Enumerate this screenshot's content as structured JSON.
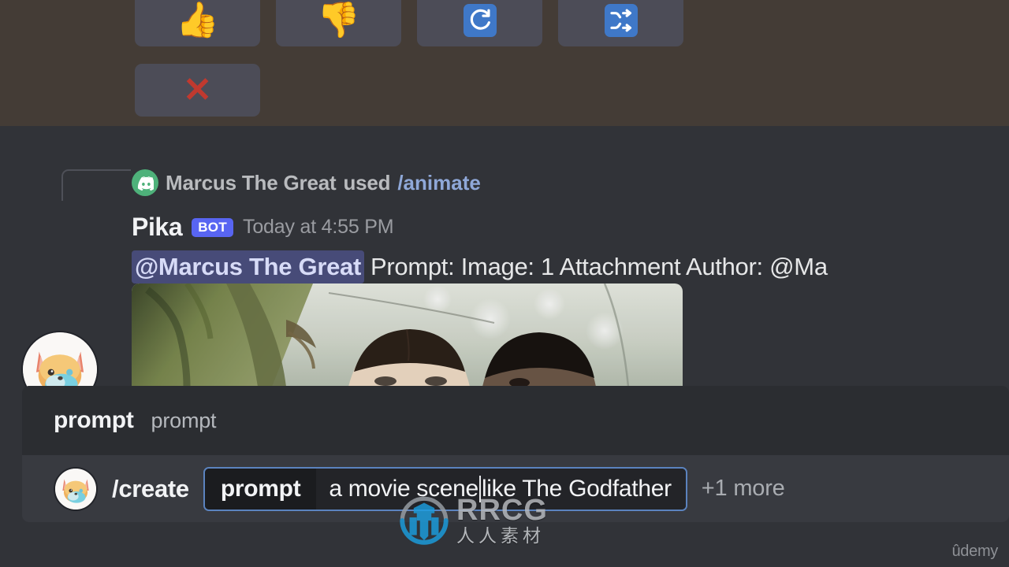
{
  "reactions": {
    "buttons": [
      {
        "name": "thumbs-up",
        "glyph": "👍",
        "kind": "emoji"
      },
      {
        "name": "thumbs-down",
        "glyph": "👎",
        "kind": "emoji"
      },
      {
        "name": "reload",
        "glyph": "🔄",
        "kind": "tile-icon"
      },
      {
        "name": "shuffle",
        "glyph": "🔀",
        "kind": "tile-icon"
      },
      {
        "name": "cancel",
        "glyph": "❌",
        "kind": "x"
      }
    ],
    "tile_color": "#3f78c8",
    "button_bg": "#4c4c57",
    "highlight_bg": "#443c36"
  },
  "message": {
    "reply_user": "Marcus The Great",
    "reply_used_word": "used",
    "reply_command": "/animate",
    "author": "Pika",
    "bot_badge": "BOT",
    "timestamp": "Today at 4:55 PM",
    "mention": "@Marcus The Great",
    "fields": "Prompt:   Image: 1 Attachment  Author: @Ma",
    "accent_blurple": "#5865f2",
    "mention_bg": "#474b78"
  },
  "option_hint": {
    "name": "prompt",
    "description": "prompt"
  },
  "composer": {
    "command": "/create",
    "param_key": "prompt",
    "param_value_before_caret": "a movie scene",
    "param_value_after_caret": "like The Godfather",
    "more_label": "+1 more",
    "border_color": "#5b83bf"
  },
  "watermarks": {
    "rrcg_title": "RRCG",
    "rrcg_sub": "人人素材",
    "udemy": "ûdemy"
  }
}
